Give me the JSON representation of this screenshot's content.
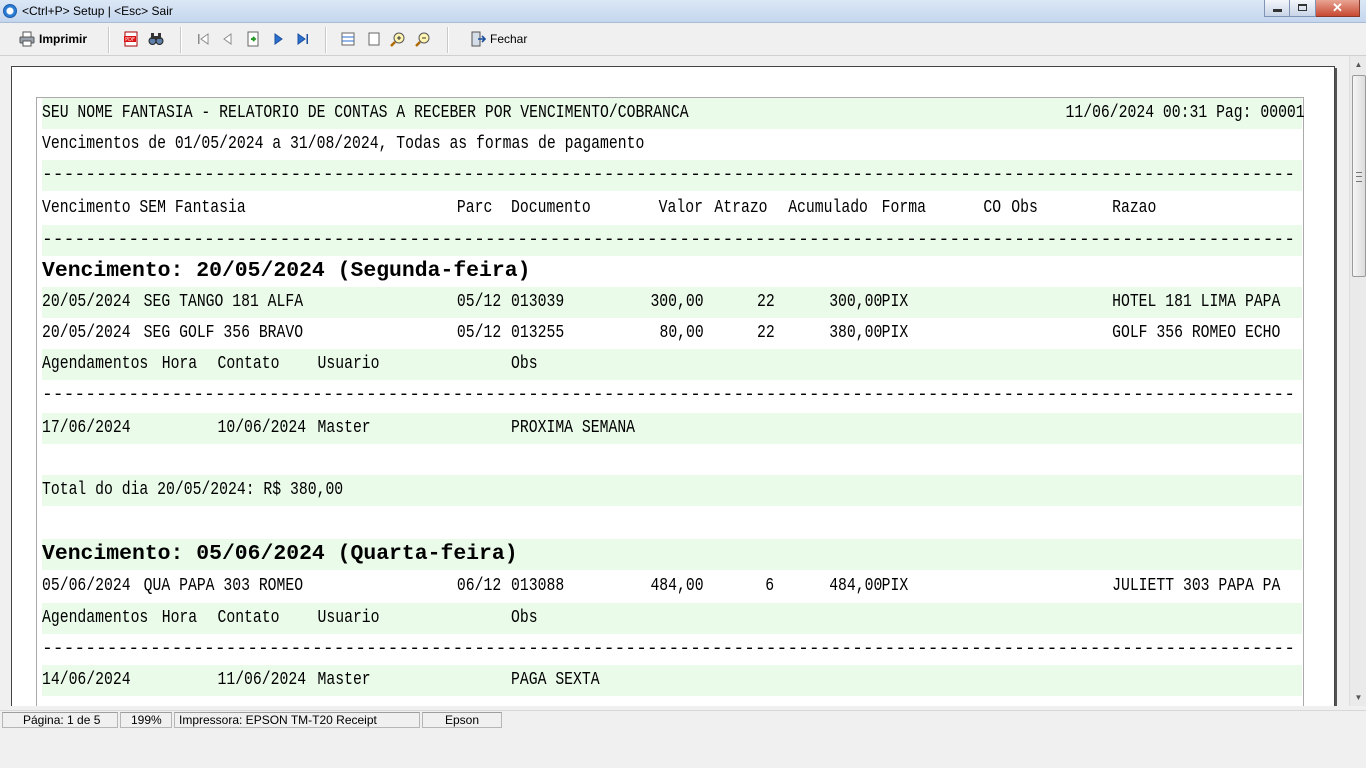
{
  "window": {
    "title": "<Ctrl+P> Setup | <Esc> Sair",
    "close_glyph": "✕"
  },
  "toolbar": {
    "print_label": "Imprimir",
    "close_label": "Fechar"
  },
  "report": {
    "header_left": "SEU NOME FANTASIA - RELATORIO DE CONTAS A RECEBER POR VENCIMENTO/COBRANCA",
    "header_right": "11/06/2024 00:31 Pag: 00001",
    "subtitle": "Vencimentos de 01/05/2024 a 31/08/2024, Todas as formas de pagamento",
    "separator": "------------------------------------------------------------------------------------------------------------------------------------------------------",
    "columns": {
      "vencimento": "Vencimento SEM Fantasia",
      "parc": "Parc",
      "documento": "Documento",
      "valor": "Valor",
      "atrazo": "Atrazo",
      "acumulado": "Acumulado",
      "forma": "Forma",
      "co": "CO",
      "obs": "Obs",
      "razao": "Razao"
    },
    "groups": [
      {
        "heading": "Vencimento:  20/05/2024 (Segunda-feira)",
        "rows": [
          {
            "venc": "20/05/2024",
            "fantasia": "SEG TANGO 181 ALFA",
            "parc": "05/12",
            "doc": "013039",
            "valor": "300,00",
            "atrazo": "22",
            "acumulado": "300,00",
            "forma": "PIX",
            "razao": "HOTEL 181 LIMA PAPA"
          },
          {
            "venc": "20/05/2024",
            "fantasia": "SEG GOLF 356 BRAVO",
            "parc": "05/12",
            "doc": "013255",
            "valor": "80,00",
            "atrazo": "22",
            "acumulado": "380,00",
            "forma": "PIX",
            "razao": "GOLF 356 ROMEO ECHO"
          }
        ],
        "sched_header": {
          "agend": "Agendamentos",
          "hora": "Hora",
          "contato": "Contato",
          "usuario": "Usuario",
          "obs": "Obs"
        },
        "schedules": [
          {
            "agend": "17/06/2024",
            "contato": "10/06/2024",
            "usuario": "Master",
            "obs": "PROXIMA SEMANA"
          }
        ],
        "total": "Total do dia 20/05/2024: R$     380,00"
      },
      {
        "heading": "Vencimento:  05/06/2024 (Quarta-feira)",
        "rows": [
          {
            "venc": "05/06/2024",
            "fantasia": "QUA PAPA 303 ROMEO",
            "parc": "06/12",
            "doc": "013088",
            "valor": "484,00",
            "atrazo": "6",
            "acumulado": "484,00",
            "forma": "PIX",
            "razao": "JULIETT 303 PAPA PA"
          }
        ],
        "sched_header": {
          "agend": "Agendamentos",
          "hora": "Hora",
          "contato": "Contato",
          "usuario": "Usuario",
          "obs": "Obs"
        },
        "schedules": [
          {
            "agend": "14/06/2024",
            "contato": "11/06/2024",
            "usuario": "Master",
            "obs": "PAGA SEXTA"
          }
        ]
      }
    ]
  },
  "statusbar": {
    "page": "Página: 1 de 5",
    "zoom": "199%",
    "printer": "Impressora: EPSON TM-T20 Receipt",
    "port": "Epson"
  },
  "colors": {
    "row_band": "#eafbea",
    "titlebar": "#c4d6ee"
  }
}
